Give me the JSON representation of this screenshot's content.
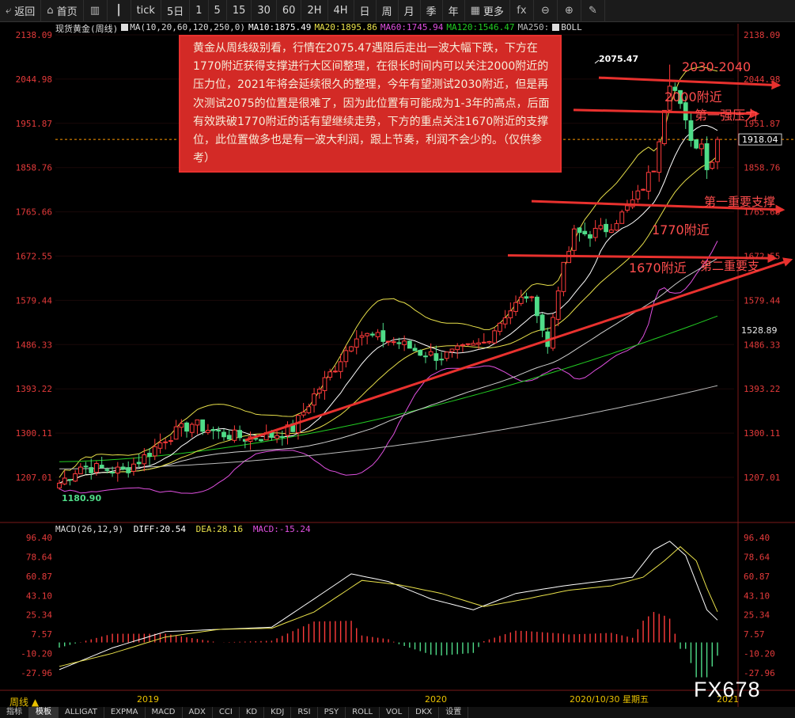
{
  "toolbar": {
    "items": [
      {
        "label": "返回",
        "icon": "back-icon",
        "glyph": "⤶"
      },
      {
        "label": "首页",
        "icon": "home-icon",
        "glyph": "⌂"
      },
      {
        "label": "",
        "icon": "kline-icon",
        "glyph": "▥"
      },
      {
        "label": "",
        "icon": "chart-type-icon",
        "glyph": "┃"
      },
      {
        "label": "tick",
        "icon": "",
        "glyph": ""
      },
      {
        "label": "5日",
        "icon": "",
        "glyph": ""
      },
      {
        "label": "1",
        "icon": "",
        "glyph": ""
      },
      {
        "label": "5",
        "icon": "",
        "glyph": ""
      },
      {
        "label": "15",
        "icon": "",
        "glyph": ""
      },
      {
        "label": "30",
        "icon": "",
        "glyph": ""
      },
      {
        "label": "60",
        "icon": "",
        "glyph": ""
      },
      {
        "label": "2H",
        "icon": "",
        "glyph": ""
      },
      {
        "label": "4H",
        "icon": "",
        "glyph": ""
      },
      {
        "label": "日",
        "icon": "",
        "glyph": ""
      },
      {
        "label": "周",
        "icon": "",
        "glyph": ""
      },
      {
        "label": "月",
        "icon": "",
        "glyph": ""
      },
      {
        "label": "季",
        "icon": "",
        "glyph": ""
      },
      {
        "label": "年",
        "icon": "",
        "glyph": ""
      },
      {
        "label": "更多",
        "icon": "more-icon",
        "glyph": "▦"
      },
      {
        "label": "",
        "icon": "formula-icon",
        "glyph": "fx"
      },
      {
        "label": "",
        "icon": "zoom-out-icon",
        "glyph": "⊖"
      },
      {
        "label": "",
        "icon": "zoom-in-icon",
        "glyph": "⊕"
      },
      {
        "label": "",
        "icon": "draw-icon",
        "glyph": "✎"
      }
    ]
  },
  "legend": {
    "symbol": "现货黄金(周线)",
    "ma_params": "MA(10,20,60,120,250,0)",
    "ma10": "MA10:1875.49",
    "ma20": "MA20:1895.86",
    "ma60": "MA60:1745.94",
    "ma120": "MA120:1546.47",
    "ma250": "MA250:",
    "boll": "BOLL"
  },
  "macd_legend": {
    "params": "MACD(26,12,9)",
    "diff": "DIFF:20.54",
    "dea": "DEA:28.16",
    "macd": "MACD:-15.24"
  },
  "annotation_text": "黄金从周线级别看，行情在2075.47遇阻后走出一波大幅下跌，下方在1770附近获得支撑进行大区间整理，在很长时间内可以关注2000附近的压力位，2021年将会延续很久的整理，今年有望测试2030附近，但是再次测试2075的位置是很难了，因为此位置有可能成为1-3年的高点，后面有效跌破1770附近的话有望继续走势，下方的重点关注1670附近的支撑位，此位置做多也是有一波大利润，跟上节奏，利润不会少的。（仅供参考）",
  "labels": {
    "r2030": "2030-2040",
    "r2000": "2000附近",
    "strong_resist": "第一强压力",
    "s1": "第一重要支撑",
    "s1770": "1770附近",
    "s1670": "1670附近",
    "s2": "第二重要支",
    "high_label": "2075.47",
    "low_label": "1180.90",
    "current": "1918.04",
    "level_1528": "1528.89"
  },
  "x_axis": {
    "ticks": [
      "2019",
      "2020",
      "2020/10/30 星期五",
      "2021"
    ]
  },
  "bottom_tabs": [
    "指标",
    "模板",
    "ALLIGAT",
    "EXPMA",
    "MACD",
    "ADX",
    "CCI",
    "KD",
    "KDJ",
    "RSI",
    "PSY",
    "ROLL",
    "VOL",
    "DKX",
    "设置"
  ],
  "period": "周线 ▲",
  "watermark": "FX678",
  "colors": {
    "up": "#ff3b3b",
    "down": "#4fdc88",
    "ma10": "#ffffff",
    "ma20": "#e8e04a",
    "ma60": "#e050e0",
    "ma120": "#22cc22",
    "ma250": "#bbbbbb",
    "arrow": "#e8312e",
    "axis_text": "#e33a3a"
  },
  "chart_data": [
    {
      "type": "candlestick",
      "title": "现货黄金(周线)",
      "y_ticks": [
        2138.09,
        2044.98,
        1951.87,
        1858.76,
        1765.66,
        1672.55,
        1579.44,
        1486.33,
        1393.22,
        1300.11,
        1207.01
      ],
      "ylim": [
        1140,
        2138.09
      ],
      "x_ticks": [
        "2019",
        "2020",
        "2021"
      ],
      "annotations": [
        "2075.47",
        "1180.90"
      ],
      "current_price": 1918.04,
      "key_values": {
        "high": 2075.47,
        "low": 1180.9
      },
      "series_last_values": {
        "MA10": 1875.49,
        "MA20": 1895.86,
        "MA60": 1745.94,
        "MA120": 1546.47
      },
      "levels": {
        "resistance_2030_2040": 2040,
        "resistance_2000": 2000,
        "support_1770": 1770,
        "support_1670": 1670
      }
    },
    {
      "type": "line+bar",
      "title": "MACD(26,12,9)",
      "y_ticks": [
        96.4,
        78.64,
        60.87,
        43.1,
        25.34,
        7.57,
        -10.2,
        -27.96
      ],
      "ylim": [
        -40,
        100
      ],
      "last_values": {
        "DIFF": 20.54,
        "DEA": 28.16,
        "MACD": -15.24
      }
    }
  ]
}
